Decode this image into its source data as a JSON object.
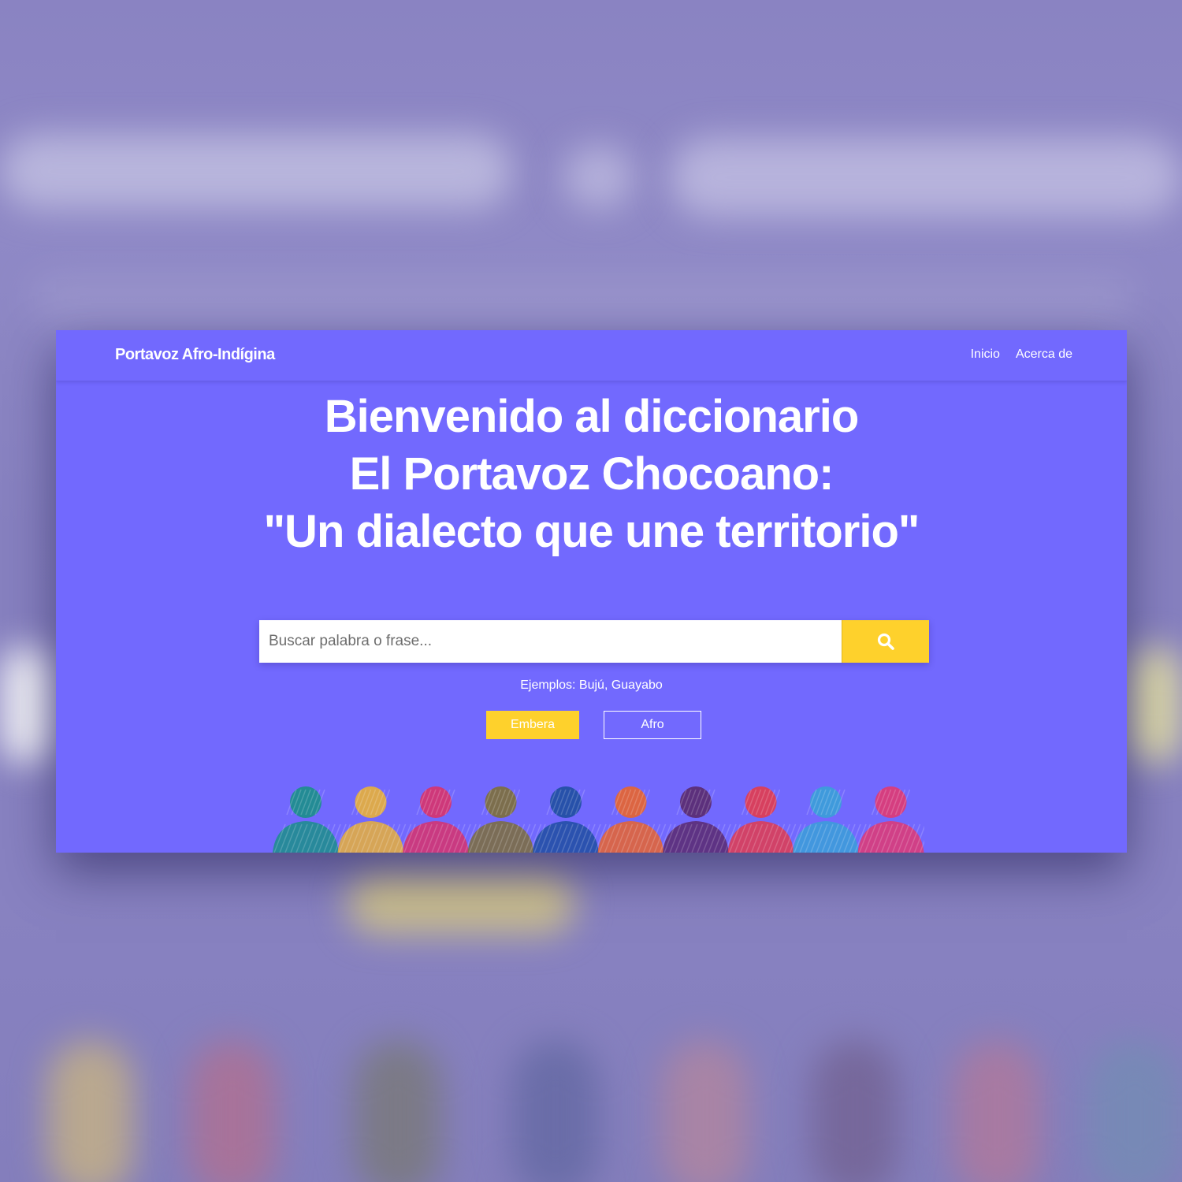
{
  "navbar": {
    "brand": "Portavoz Afro-Indígina",
    "links": [
      {
        "label": "Inicio"
      },
      {
        "label": "Acerca de"
      }
    ]
  },
  "hero": {
    "title_lines": [
      "Bienvenido al diccionario",
      "El Portavoz Chocoano:",
      "\"Un dialecto que une territorio\""
    ]
  },
  "search": {
    "placeholder": "Buscar palabra o frase...",
    "value": "",
    "button_icon": "search-icon"
  },
  "examples": "Ejemplos: Bujú, Guayabo",
  "language_buttons": [
    {
      "label": "Embera",
      "active": true
    },
    {
      "label": "Afro",
      "active": false
    }
  ],
  "people_illustration": {
    "colors": [
      "#1b8f8a",
      "#e8b03a",
      "#d8336b",
      "#7d6f3a",
      "#1f4fa1",
      "#e8652e",
      "#5a2a6e",
      "#e23c4e",
      "#3aa0d8",
      "#e03a72"
    ]
  },
  "colors": {
    "primary": "#7269fe",
    "accent": "#fed12c",
    "text": "#ffffff"
  }
}
